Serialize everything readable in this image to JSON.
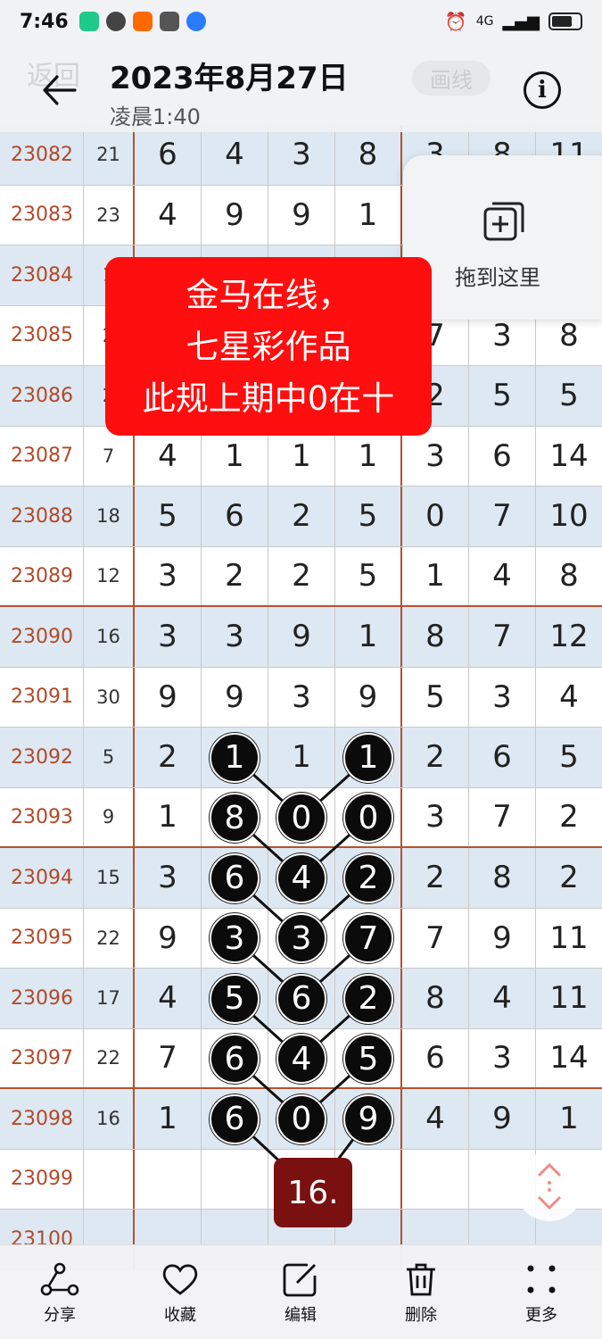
{
  "status_bar": {
    "time": "7:46",
    "network": "4G"
  },
  "header": {
    "title": "2023年8月27日",
    "subtitle": "凌晨1:40",
    "ghost_back": "返回",
    "ghost_button": "画线"
  },
  "drop_target": {
    "label": "拖到这里"
  },
  "banner": {
    "line1": "金马在线，",
    "line2": "七星彩作品",
    "line3": "此规上期中0在十"
  },
  "table": {
    "rows": [
      {
        "period": "23082",
        "sum": "21",
        "d": [
          "6",
          "4",
          "3",
          "8"
        ],
        "e": [
          "3",
          "8",
          "11"
        ]
      },
      {
        "period": "23083",
        "sum": "23",
        "d": [
          "4",
          "9",
          "9",
          "1"
        ],
        "e": [
          "",
          "",
          ""
        ]
      },
      {
        "period": "23084",
        "sum": "1",
        "d": [
          "",
          "",
          "",
          ""
        ],
        "e": [
          "",
          "",
          ""
        ]
      },
      {
        "period": "23085",
        "sum": "2",
        "d": [
          "",
          "",
          "",
          ""
        ],
        "e": [
          "7",
          "3",
          "8"
        ]
      },
      {
        "period": "23086",
        "sum": "2",
        "d": [
          "",
          "",
          "",
          ""
        ],
        "e": [
          "2",
          "5",
          "5"
        ]
      },
      {
        "period": "23087",
        "sum": "7",
        "d": [
          "4",
          "1",
          "1",
          "1"
        ],
        "e": [
          "3",
          "6",
          "14"
        ]
      },
      {
        "period": "23088",
        "sum": "18",
        "d": [
          "5",
          "6",
          "2",
          "5"
        ],
        "e": [
          "0",
          "7",
          "10"
        ]
      },
      {
        "period": "23089",
        "sum": "12",
        "d": [
          "3",
          "2",
          "2",
          "5"
        ],
        "e": [
          "1",
          "4",
          "8"
        ]
      },
      {
        "period": "23090",
        "sum": "16",
        "d": [
          "3",
          "3",
          "9",
          "1"
        ],
        "e": [
          "8",
          "7",
          "12"
        ]
      },
      {
        "period": "23091",
        "sum": "30",
        "d": [
          "9",
          "9",
          "3",
          "9"
        ],
        "e": [
          "5",
          "3",
          "4"
        ]
      },
      {
        "period": "23092",
        "sum": "5",
        "d": [
          "2",
          "",
          "1",
          ""
        ],
        "e": [
          "2",
          "6",
          "5"
        ]
      },
      {
        "period": "23093",
        "sum": "9",
        "d": [
          "1",
          "",
          "",
          ""
        ],
        "e": [
          "3",
          "7",
          "2"
        ]
      },
      {
        "period": "23094",
        "sum": "15",
        "d": [
          "3",
          "",
          "",
          ""
        ],
        "e": [
          "2",
          "8",
          "2"
        ]
      },
      {
        "period": "23095",
        "sum": "22",
        "d": [
          "9",
          "",
          "",
          ""
        ],
        "e": [
          "7",
          "9",
          "11"
        ]
      },
      {
        "period": "23096",
        "sum": "17",
        "d": [
          "4",
          "",
          "",
          ""
        ],
        "e": [
          "8",
          "4",
          "11"
        ]
      },
      {
        "period": "23097",
        "sum": "22",
        "d": [
          "7",
          "",
          "",
          ""
        ],
        "e": [
          "6",
          "3",
          "14"
        ]
      },
      {
        "period": "23098",
        "sum": "16",
        "d": [
          "1",
          "",
          "",
          ""
        ],
        "e": [
          "4",
          "9",
          "1"
        ]
      },
      {
        "period": "23099",
        "sum": "",
        "d": [
          "",
          "",
          "",
          ""
        ],
        "e": [
          "",
          "",
          ""
        ]
      },
      {
        "period": "23100",
        "sum": "",
        "d": [
          "",
          "",
          "",
          ""
        ],
        "e": [
          "",
          "",
          ""
        ]
      }
    ]
  },
  "balls": [
    {
      "row": 10,
      "col": 1,
      "v": "1"
    },
    {
      "row": 10,
      "col": 3,
      "v": "1"
    },
    {
      "row": 11,
      "col": 1,
      "v": "8"
    },
    {
      "row": 11,
      "col": 2,
      "v": "0"
    },
    {
      "row": 11,
      "col": 3,
      "v": "0"
    },
    {
      "row": 12,
      "col": 1,
      "v": "6"
    },
    {
      "row": 12,
      "col": 2,
      "v": "4"
    },
    {
      "row": 12,
      "col": 3,
      "v": "2"
    },
    {
      "row": 13,
      "col": 1,
      "v": "3"
    },
    {
      "row": 13,
      "col": 2,
      "v": "3"
    },
    {
      "row": 13,
      "col": 3,
      "v": "7"
    },
    {
      "row": 14,
      "col": 1,
      "v": "5"
    },
    {
      "row": 14,
      "col": 2,
      "v": "6"
    },
    {
      "row": 14,
      "col": 3,
      "v": "2"
    },
    {
      "row": 15,
      "col": 1,
      "v": "6"
    },
    {
      "row": 15,
      "col": 2,
      "v": "4"
    },
    {
      "row": 15,
      "col": 3,
      "v": "5"
    },
    {
      "row": 16,
      "col": 1,
      "v": "6"
    },
    {
      "row": 16,
      "col": 2,
      "v": "0"
    },
    {
      "row": 16,
      "col": 3,
      "v": "9"
    }
  ],
  "result_badge": "16.",
  "bottom_bar": {
    "share": "分享",
    "favorite": "收藏",
    "edit": "编辑",
    "delete": "删除",
    "more": "更多"
  }
}
